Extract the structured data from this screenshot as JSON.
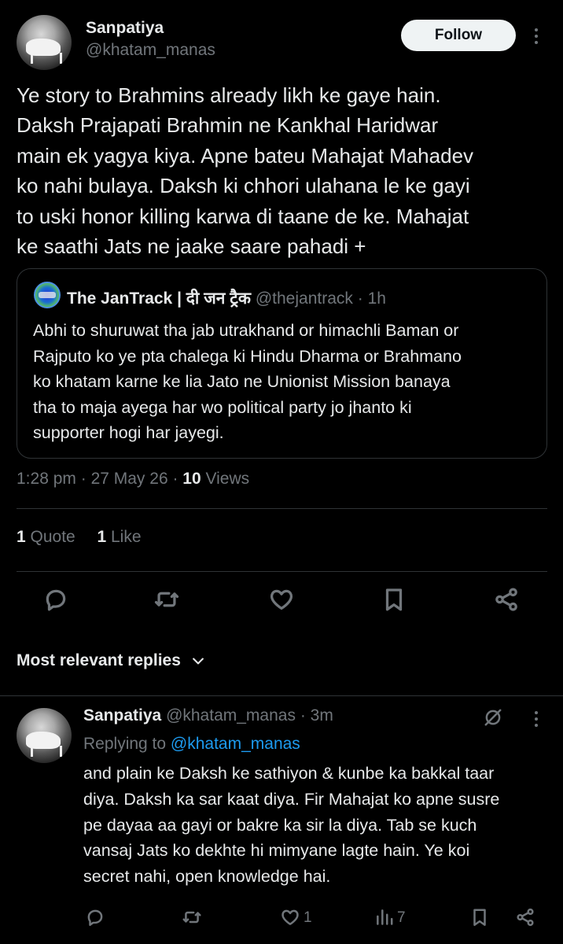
{
  "main_post": {
    "display_name": "Sanpatiya",
    "handle": "@khatam_manas",
    "follow_label": "Follow",
    "text": "Ye story to Brahmins already likh ke gaye hain.\nDaksh Prajapati Brahmin ne Kankhal Haridwar\nmain ek yagya kiya. Apne bateu Mahajat Mahadev\nko nahi bulaya. Daksh ki chhori ulahana le ke gayi\nto uski honor killing karwa di taane de ke. Mahajat\nke saathi Jats ne jaake saare pahadi +",
    "time": "1:28 pm",
    "date": "27 May 26",
    "views_count": "10",
    "views_label": "Views",
    "quotes_count": "1",
    "quotes_label": "Quote",
    "likes_count": "1",
    "likes_label": "Like"
  },
  "quoted_post": {
    "display_name": "The JanTrack | दी जन ट्रैक",
    "handle": "@thejantrack",
    "age": "1h",
    "text": "Abhi to shuruwat tha jab utrakhand or himachli Baman or\nRajputo ko ye pta chalega ki Hindu Dharma or Brahmano\nko khatam karne ke lia Jato ne Unionist Mission banaya\ntha to maja ayega har wo political party jo jhanto ki\nsupporter hogi har jayegi."
  },
  "actions": {
    "reply_icon": "reply-icon",
    "repost_icon": "repost-icon",
    "like_icon": "heart-icon",
    "bookmark_icon": "bookmark-icon",
    "share_icon": "share-icon"
  },
  "replies_section": {
    "sort_label": "Most relevant replies"
  },
  "reply": {
    "display_name": "Sanpatiya",
    "handle": "@khatam_manas",
    "age": "3m",
    "replying_prefix": "Replying to",
    "replying_handle": "@khatam_manas",
    "text": "and plain ke Daksh ke sathiyon & kunbe ka bakkal taar\ndiya. Daksh ka sar kaat diya. Fir Mahajat ko apne susre\npe dayaa aa gayi or bakre ka sir la diya. Tab se kuch\nvansaj Jats ko dekhte hi mimyane lagte hain. Ye koi\nsecret nahi, open knowledge hai.",
    "likes_count": "1",
    "views_count": "7"
  },
  "colors": {
    "background": "#000000",
    "text_primary": "#e7e9ea",
    "text_secondary": "#71767b",
    "link": "#1d9bf0",
    "border": "#2f3336",
    "follow_bg": "#eff3f4"
  }
}
